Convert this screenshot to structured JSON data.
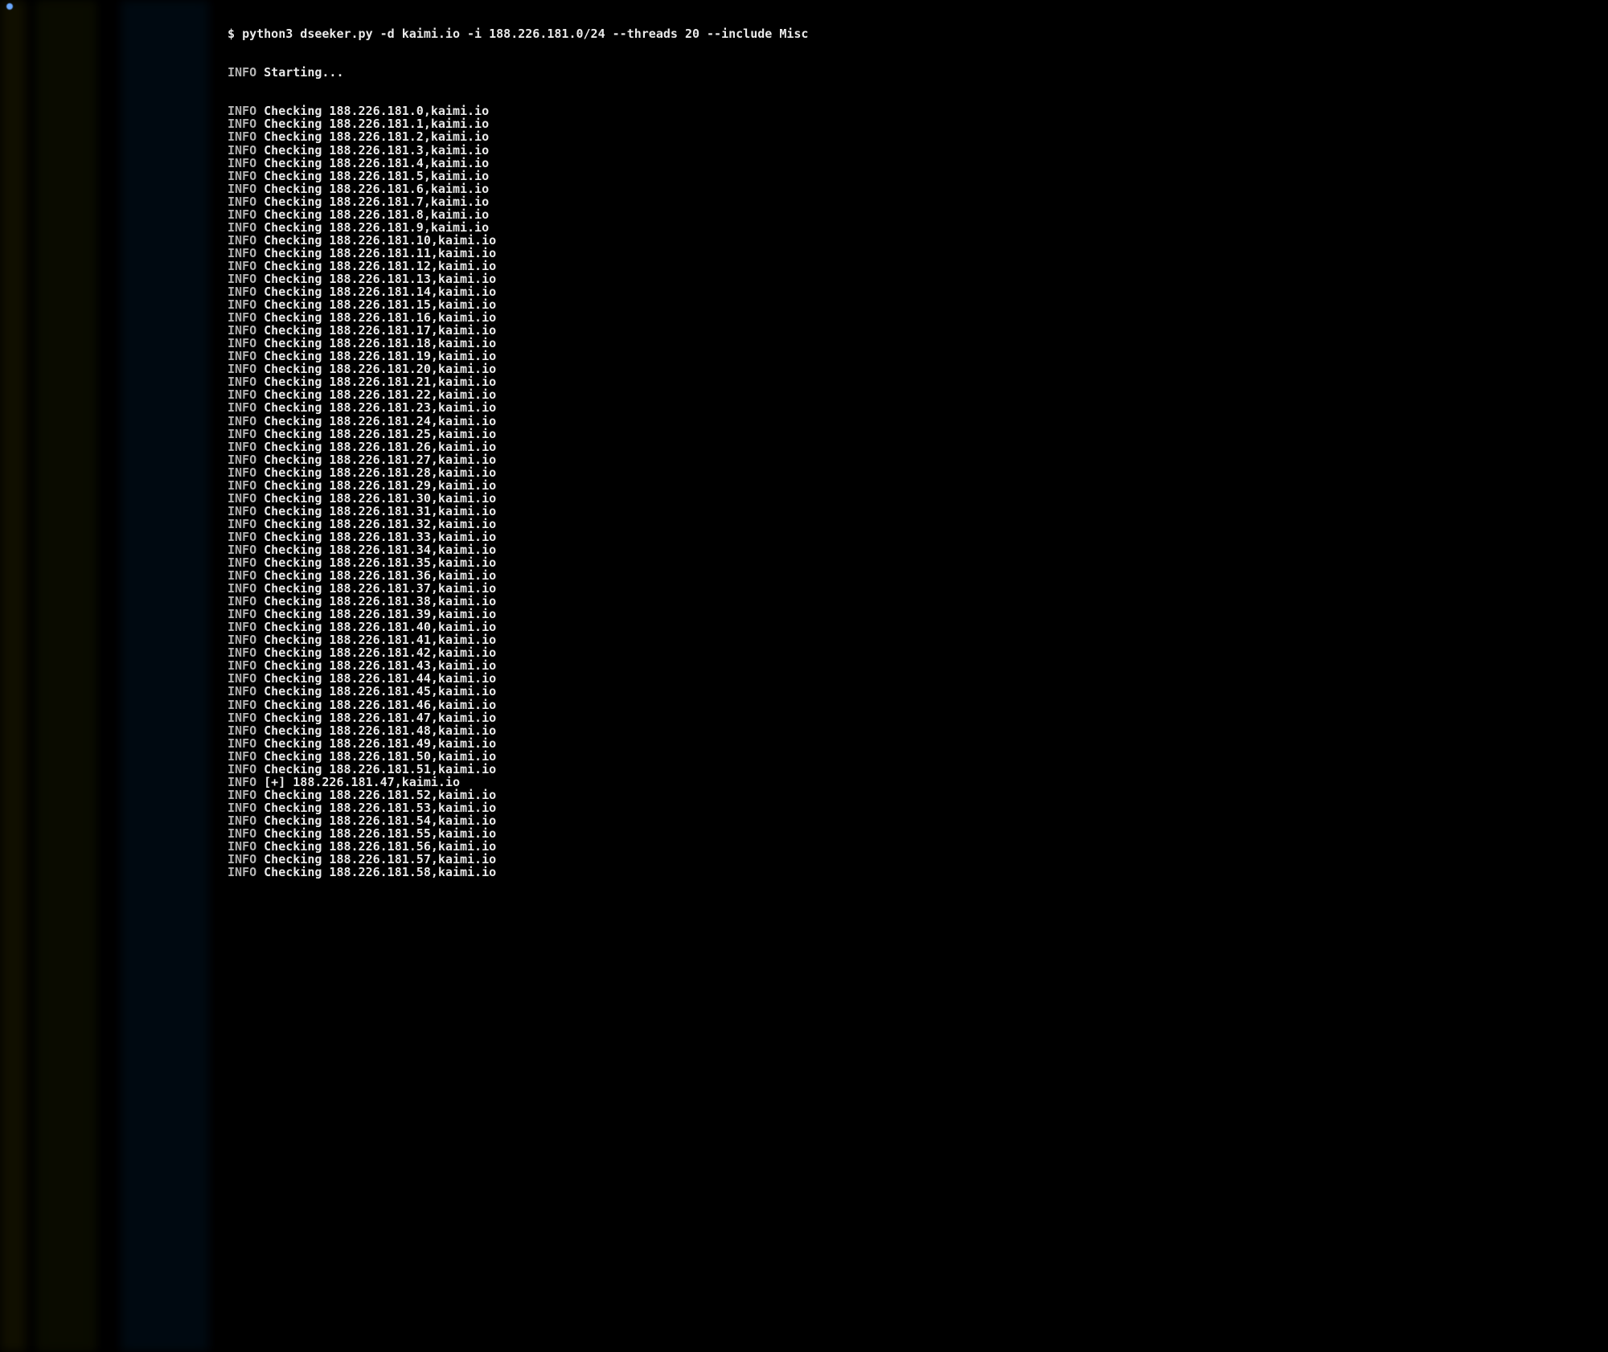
{
  "prompt": {
    "dollar": "$",
    "command": "python3 dseeker.py -d kaimi.io -i 188.226.181.0/24 --threads 20 --include Misc"
  },
  "info_label": "INFO",
  "starting_msg": "Starting...",
  "ip_base": "188.226.181.",
  "domain": "kaimi.io",
  "check_prefix": "Checking ",
  "found_prefix": "[+] ",
  "lines": [
    {
      "t": "check",
      "n": 0
    },
    {
      "t": "check",
      "n": 1
    },
    {
      "t": "check",
      "n": 2
    },
    {
      "t": "check",
      "n": 3
    },
    {
      "t": "check",
      "n": 4
    },
    {
      "t": "check",
      "n": 5
    },
    {
      "t": "check",
      "n": 6
    },
    {
      "t": "check",
      "n": 7
    },
    {
      "t": "check",
      "n": 8
    },
    {
      "t": "check",
      "n": 9
    },
    {
      "t": "check",
      "n": 10
    },
    {
      "t": "check",
      "n": 11
    },
    {
      "t": "check",
      "n": 12
    },
    {
      "t": "check",
      "n": 13
    },
    {
      "t": "check",
      "n": 14
    },
    {
      "t": "check",
      "n": 15
    },
    {
      "t": "check",
      "n": 16
    },
    {
      "t": "check",
      "n": 17
    },
    {
      "t": "check",
      "n": 18
    },
    {
      "t": "check",
      "n": 19
    },
    {
      "t": "check",
      "n": 20
    },
    {
      "t": "check",
      "n": 21
    },
    {
      "t": "check",
      "n": 22
    },
    {
      "t": "check",
      "n": 23
    },
    {
      "t": "check",
      "n": 24
    },
    {
      "t": "check",
      "n": 25
    },
    {
      "t": "check",
      "n": 26
    },
    {
      "t": "check",
      "n": 27
    },
    {
      "t": "check",
      "n": 28
    },
    {
      "t": "check",
      "n": 29
    },
    {
      "t": "check",
      "n": 30
    },
    {
      "t": "check",
      "n": 31
    },
    {
      "t": "check",
      "n": 32
    },
    {
      "t": "check",
      "n": 33
    },
    {
      "t": "check",
      "n": 34
    },
    {
      "t": "check",
      "n": 35
    },
    {
      "t": "check",
      "n": 36
    },
    {
      "t": "check",
      "n": 37
    },
    {
      "t": "check",
      "n": 38
    },
    {
      "t": "check",
      "n": 39
    },
    {
      "t": "check",
      "n": 40
    },
    {
      "t": "check",
      "n": 41
    },
    {
      "t": "check",
      "n": 42
    },
    {
      "t": "check",
      "n": 43
    },
    {
      "t": "check",
      "n": 44
    },
    {
      "t": "check",
      "n": 45
    },
    {
      "t": "check",
      "n": 46
    },
    {
      "t": "check",
      "n": 47
    },
    {
      "t": "check",
      "n": 48
    },
    {
      "t": "check",
      "n": 49
    },
    {
      "t": "check",
      "n": 50
    },
    {
      "t": "check",
      "n": 51
    },
    {
      "t": "found",
      "n": 47
    },
    {
      "t": "check",
      "n": 52
    },
    {
      "t": "check",
      "n": 53
    },
    {
      "t": "check",
      "n": 54
    },
    {
      "t": "check",
      "n": 55
    },
    {
      "t": "check",
      "n": 56
    },
    {
      "t": "check",
      "n": 57
    },
    {
      "t": "check",
      "n": 58
    }
  ]
}
